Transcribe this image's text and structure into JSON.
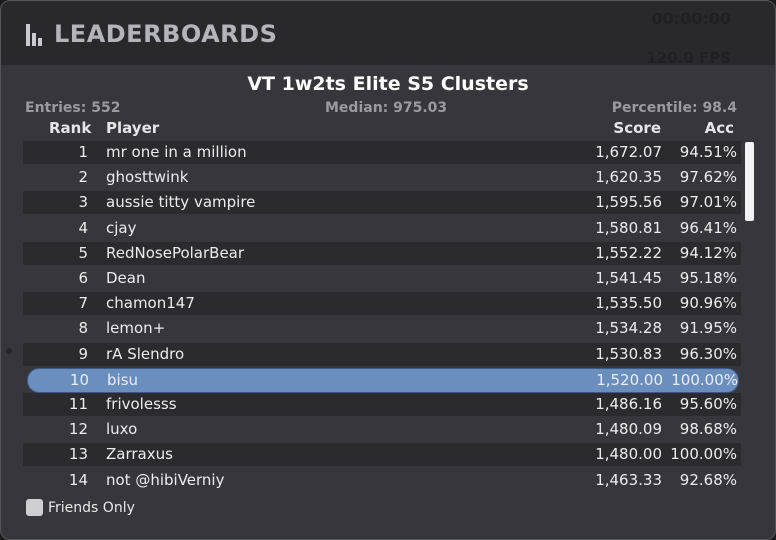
{
  "window": {
    "title": "LEADERBOARDS",
    "icon": "bar-chart-icon",
    "timer": "00:00:00",
    "fps": "120.0 FPS"
  },
  "board": {
    "title": "VT 1w2ts Elite S5 Clusters",
    "entries": "Entries: 552",
    "median": "Median: 975.03",
    "percentile": "Percentile: 98.4"
  },
  "columns": {
    "rank": "Rank",
    "player": "Player",
    "score": "Score",
    "acc": "Acc"
  },
  "rows": [
    {
      "rank": "1",
      "player": "mr one in a million",
      "score": "1,672.07",
      "acc": "94.51%"
    },
    {
      "rank": "2",
      "player": "ghosttwink",
      "score": "1,620.35",
      "acc": "97.62%"
    },
    {
      "rank": "3",
      "player": "aussie titty vampire",
      "score": "1,595.56",
      "acc": "97.01%"
    },
    {
      "rank": "4",
      "player": "cjay",
      "score": "1,580.81",
      "acc": "96.41%"
    },
    {
      "rank": "5",
      "player": "RedNosePolarBear",
      "score": "1,552.22",
      "acc": "94.12%"
    },
    {
      "rank": "6",
      "player": "Dean",
      "score": "1,541.45",
      "acc": "95.18%"
    },
    {
      "rank": "7",
      "player": "chamon147",
      "score": "1,535.50",
      "acc": "90.96%"
    },
    {
      "rank": "8",
      "player": "lemon+",
      "score": "1,534.28",
      "acc": "91.95%"
    },
    {
      "rank": "9",
      "player": "rA Slendro",
      "score": "1,530.83",
      "acc": "96.30%"
    },
    {
      "rank": "10",
      "player": "bisu",
      "score": "1,520.00",
      "acc": "100.00%"
    },
    {
      "rank": "11",
      "player": "frivolesss",
      "score": "1,486.16",
      "acc": "95.60%"
    },
    {
      "rank": "12",
      "player": "luxo",
      "score": "1,480.09",
      "acc": "98.68%"
    },
    {
      "rank": "13",
      "player": "Zarraxus",
      "score": "1,480.00",
      "acc": "100.00%"
    },
    {
      "rank": "14",
      "player": "not @hibiVerniy",
      "score": "1,463.33",
      "acc": "92.68%"
    }
  ],
  "selected_rank": "10",
  "friends_only": {
    "label": "Friends Only",
    "checked": false
  },
  "colors": {
    "selected_row": "#6a8fbe",
    "odd_row": "#2a2a2f",
    "panel": "#36363c",
    "header": "#29292d"
  }
}
